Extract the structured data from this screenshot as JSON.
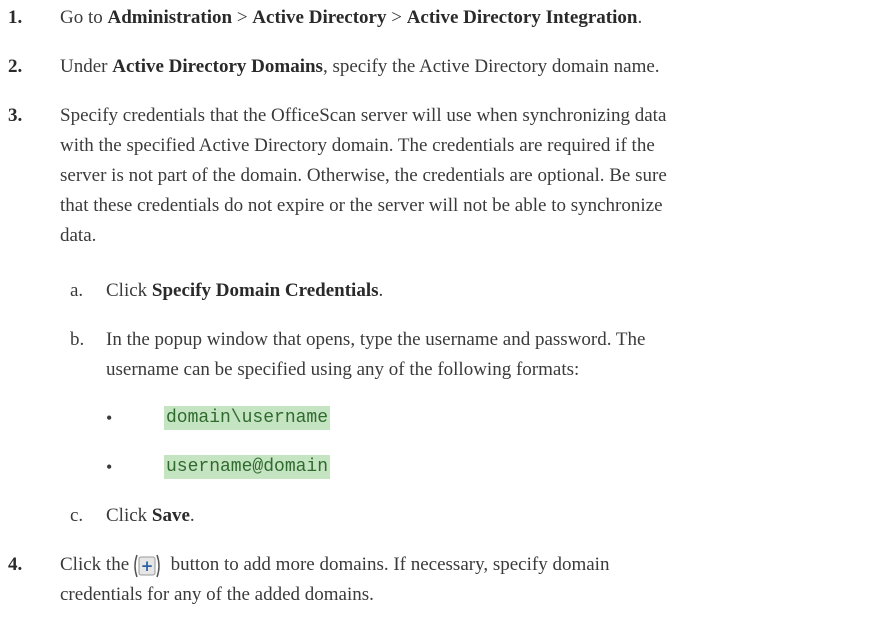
{
  "steps": [
    {
      "num": "1.",
      "pre": "Go to ",
      "b1": "Administration",
      "sep1": " > ",
      "b2": "Active Directory",
      "sep2": " > ",
      "b3": "Active Directory Integration",
      "post": "."
    },
    {
      "num": "2.",
      "pre": "Under ",
      "b1": "Active Directory Domains",
      "post": ", specify the Active Directory domain name."
    },
    {
      "num": "3.",
      "lines": [
        "Specify credentials that the OfficeScan server will use when synchronizing data",
        "with the specified Active Directory domain. The credentials are required if the",
        "server is not part of the domain. Otherwise, the credentials are optional. Be sure",
        "that these credentials do not expire or the server will not be able to synchronize",
        "data."
      ],
      "substeps": {
        "a": {
          "letter": "a.",
          "pre": "Click ",
          "bold": "Specify Domain Credentials",
          "post": "."
        },
        "b": {
          "letter": "b.",
          "lines": [
            "In the popup window that opens, type the username and password. The",
            "username can be specified using any of the following formats:"
          ],
          "bullets": [
            "domain\\username",
            "username@domain"
          ]
        },
        "c": {
          "letter": "c.",
          "pre": "Click ",
          "bold": "Save",
          "post": "."
        }
      }
    },
    {
      "num": "4.",
      "pre": "Click the ",
      "button_symbol": "+",
      "post": " button to add more domains. If necessary, specify domain",
      "line2": "credentials for any of the added domains."
    }
  ],
  "bullet_symbol": "•",
  "colors": {
    "code_bg": "#c5e4c1",
    "code_text": "#2f6a2f",
    "body_text": "#3a3a3a"
  }
}
